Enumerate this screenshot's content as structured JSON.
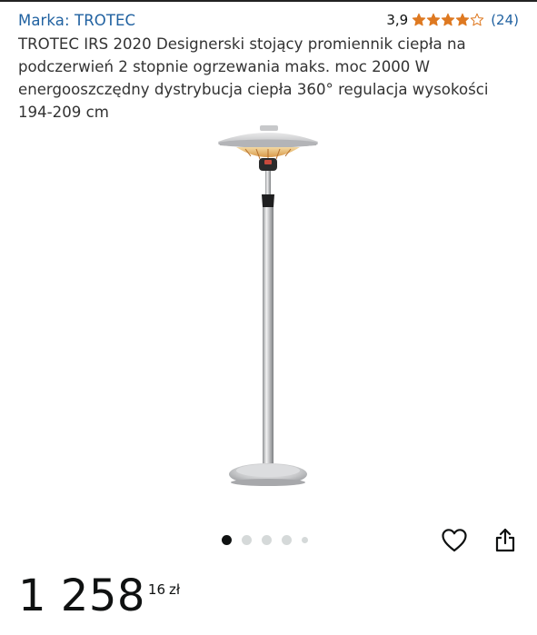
{
  "brand": {
    "label": "Marka: TROTEC"
  },
  "rating": {
    "value": "3,9",
    "stars_filled": 3.9,
    "stars_total": 5,
    "count": "(24)",
    "star_color": "#de7921",
    "star_outline_color": "#de7921"
  },
  "product": {
    "title": "TROTEC IRS 2020 Designerski stojący promiennik ciepła na podczerwień 2 stopnie ogrzewania maks. moc 2000 W energooszczędny dystrybucja ciepła 360° regulacja wysokości 194-209 cm"
  },
  "gallery": {
    "image_icon": "patio-heater-image",
    "dots_count": 5,
    "active_index": 0
  },
  "actions": {
    "wishlist_icon": "heart-outline-icon",
    "share_icon": "share-icon"
  },
  "price": {
    "whole": "1 258",
    "fraction": "16",
    "currency": "zł"
  },
  "colors": {
    "link": "#2162a1",
    "text": "#0f1111",
    "title_text": "#333333",
    "dot_inactive": "#d5d9d9"
  }
}
